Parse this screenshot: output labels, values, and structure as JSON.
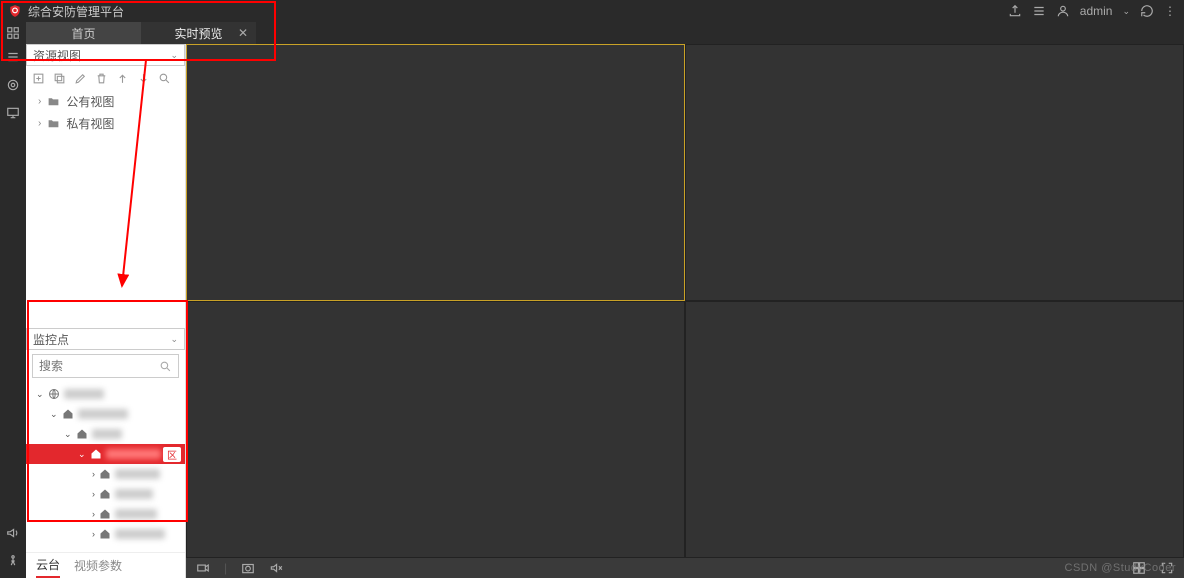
{
  "app_title": "综合安防管理平台",
  "user": "admin",
  "tabs": {
    "home": "首页",
    "preview": "实时预览"
  },
  "resource_combo": "资源视图",
  "tree": {
    "public": "公有视图",
    "private": "私有视图"
  },
  "monitor_combo": "监控点",
  "search_placeholder": "搜索",
  "selected_badge": "区",
  "bottom_tabs": {
    "ptz": "云台",
    "params": "视频参数"
  },
  "watermark": "CSDN @StudyCoder",
  "icons": {
    "logo": "shield-icon",
    "upload": "upload-icon",
    "list": "list-icon",
    "user": "user-icon",
    "refresh": "refresh-icon",
    "more": "more-icon",
    "apps": "apps-icon",
    "menu": "menu-icon",
    "target": "target-icon",
    "monitor": "monitor-icon",
    "announce": "announce-icon",
    "walk": "walk-icon",
    "new": "new-icon",
    "newwin": "newwin-icon",
    "edit": "edit-icon",
    "delete": "delete-icon",
    "up": "up-icon",
    "down": "down-icon",
    "search": "search-icon",
    "globe": "globe-icon",
    "home": "home-icon",
    "folder": "folder-icon",
    "camera": "camera-icon",
    "snapshot": "snapshot-icon",
    "mute": "mute-icon",
    "layout": "layout-icon",
    "fullscreen": "fullscreen-icon",
    "close": "close-icon",
    "chevd": "chevron-down-icon",
    "chevr": "chevron-right-icon"
  }
}
